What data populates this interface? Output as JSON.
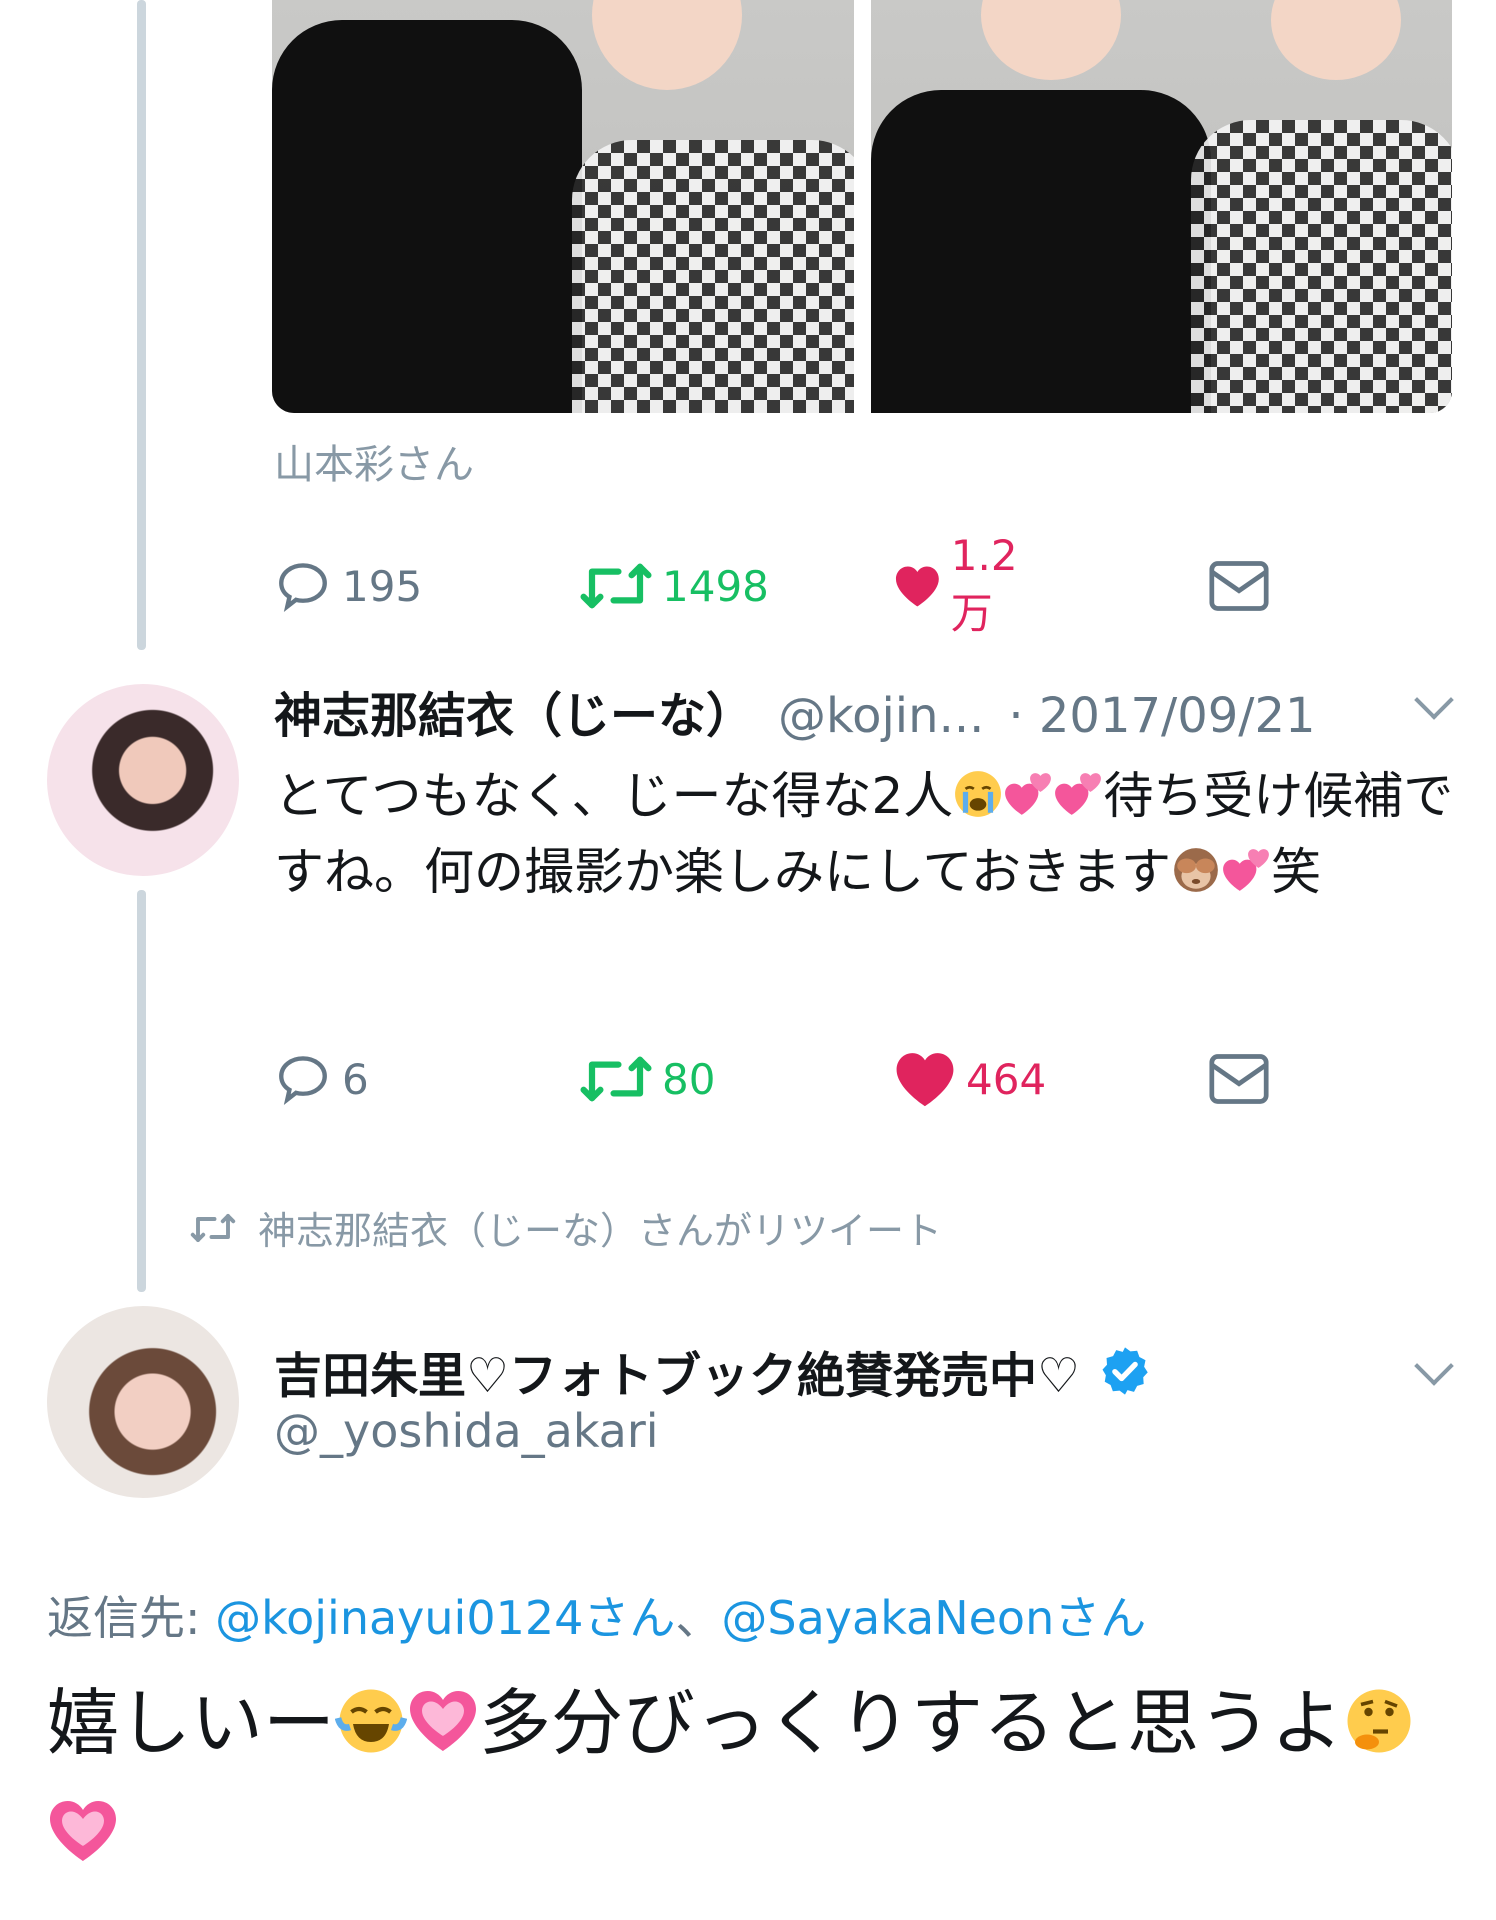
{
  "quoted_tweet": {
    "caption": "山本彩さん",
    "actions": {
      "reply_count": "195",
      "retweet_count": "1498",
      "like_count": "1.2万"
    }
  },
  "reply_tweet": {
    "display_name": "神志那結衣（じーな）",
    "handle": "@kojin...",
    "date": "· 2017/09/21",
    "text_1": "とてつもなく、じーな得な2人",
    "text_2": "待ち受け候補ですね。何の撮影か楽しみにしておきます",
    "text_3": "笑",
    "actions": {
      "reply_count": "6",
      "retweet_count": "80",
      "like_count": "464"
    }
  },
  "retweet_banner": "神志那結衣（じーな）さんがリツイート",
  "main_tweet": {
    "display_name": "吉田朱里♡フォトブック絶賛発売中♡",
    "handle": "@_yoshida_akari",
    "reply_label": "返信先: ",
    "reply_mention_1": "@kojinayui0124さん",
    "reply_sep": "、",
    "reply_mention_2": "@SayakaNeonさん",
    "text_1": "嬉しいー",
    "text_2": "多分びっくりすると思うよ"
  },
  "icons": {
    "reply": "reply-icon",
    "retweet": "retweet-icon",
    "like": "heart-icon",
    "dm": "envelope-icon",
    "verified": "verified-badge-icon",
    "caret": "chevron-down-icon"
  },
  "colors": {
    "retweet_green": "#17bf63",
    "like_red": "#e0245e",
    "link_blue": "#1b95e0",
    "gray_text": "#657786"
  }
}
